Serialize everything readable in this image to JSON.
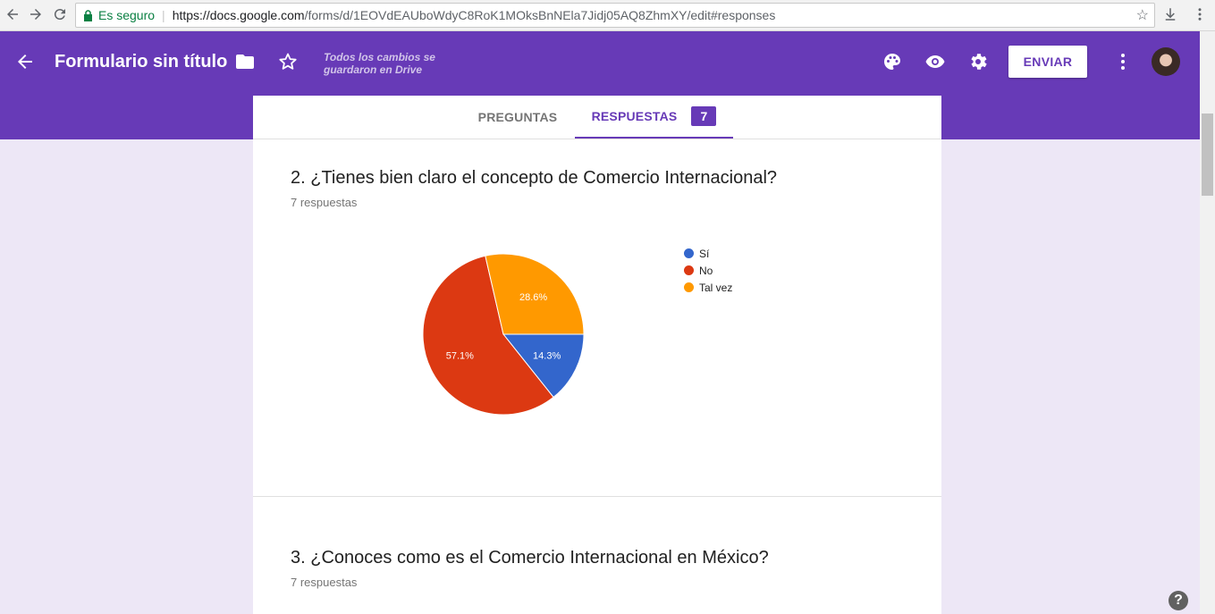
{
  "browser": {
    "secure_label": "Es seguro",
    "url_host": "https://docs.google.com",
    "url_rest": "/forms/d/1EOVdEAUboWdyC8RoK1MOksBnNEla7Jidj05AQ8ZhmXY/edit#responses"
  },
  "header": {
    "title": "Formulario sin título",
    "save_status": "Todos los cambios se guardaron en Drive",
    "send_label": "ENVIAR",
    "background": "#673ab7"
  },
  "tabs": {
    "questions_label": "PREGUNTAS",
    "responses_label": "RESPUESTAS",
    "responses_count": "7"
  },
  "question2": {
    "title": "2. ¿Tienes bien claro el concepto de Comercio Internacional?",
    "count": "7 respuestas",
    "legend": [
      "Sí",
      "No",
      "Tal vez"
    ]
  },
  "question3": {
    "title": "3. ¿Conoces como es el Comercio Internacional en México?",
    "count": "7 respuestas"
  },
  "chart_data": {
    "type": "pie",
    "categories": [
      "Sí",
      "No",
      "Tal vez"
    ],
    "values": [
      14.3,
      57.1,
      28.6
    ],
    "labels": [
      "14.3%",
      "57.1%",
      "28.6%"
    ],
    "colors": [
      "#3366cc",
      "#dc3912",
      "#ff9900"
    ],
    "legend_position": "right"
  },
  "icons": [
    "back-arrow-icon",
    "folder-icon",
    "star-icon",
    "palette-icon",
    "eye-icon",
    "gear-icon",
    "more-vert-icon",
    "help-icon",
    "lock-icon",
    "download-icon"
  ]
}
